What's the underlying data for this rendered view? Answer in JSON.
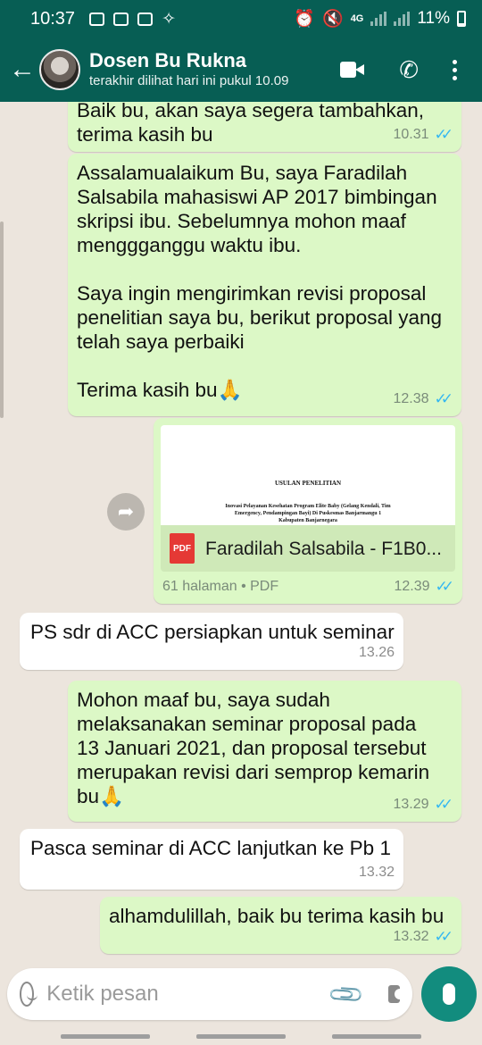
{
  "status_bar": {
    "time": "10:37",
    "network": "4G",
    "battery": "11%"
  },
  "header": {
    "contact_name": "Dosen Bu Rukna",
    "contact_status": "terakhir dilihat hari ini pukul 10.09"
  },
  "messages": [
    {
      "type": "out",
      "text": "Baik bu, akan saya segera tambahkan,\nterima kasih bu",
      "time": "10.31",
      "ticks": "✓✓"
    },
    {
      "type": "out",
      "text": "Assalamualaikum Bu, saya Faradilah\nSalsabila mahasiswi AP 2017 bimbingan\nskripsi ibu. Sebelumnya mohon maaf\nmenggganggu waktu ibu.\n\nSaya ingin mengirimkan revisi proposal\npenelitian saya bu, berikut proposal yang\ntelah saya perbaiki\n\nTerima kasih bu🙏",
      "time": "12.38",
      "ticks": "✓✓"
    },
    {
      "type": "out-doc",
      "doc_title": "USULAN PENELITIAN",
      "doc_subtitle": "Inovasi Pelayanan Kesehatan Program Elite Baby (Gelang Kendali, Tim Emergency, Pendampingan Bayi) Di Puskesmas Banjarmangu 1 Kabupaten Banjarnegara",
      "file_name": "Faradilah Salsabila - F1B0...",
      "file_type_badge": "PDF",
      "info": "61 halaman • PDF",
      "time": "12.39",
      "ticks": "✓✓"
    },
    {
      "type": "in",
      "text": "PS sdr di ACC persiapkan untuk seminar",
      "time": "13.26"
    },
    {
      "type": "out",
      "text": "Mohon maaf bu, saya sudah\nmelaksanakan seminar proposal pada\n13 Januari 2021, dan proposal tersebut\nmerupakan revisi dari semprop kemarin\nbu🙏",
      "time": "13.29",
      "ticks": "✓✓"
    },
    {
      "type": "in",
      "text": "Pasca seminar di ACC lanjutkan ke Pb 1",
      "time": "13.32"
    },
    {
      "type": "out",
      "text": "alhamdulillah, baik bu terima kasih bu",
      "time": "13.32",
      "ticks": "✓✓"
    }
  ],
  "input": {
    "placeholder": "Ketik pesan"
  }
}
